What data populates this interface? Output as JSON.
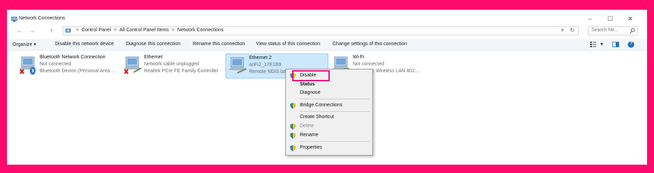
{
  "window": {
    "title": "Network Connections",
    "minimize": "–",
    "maximize": "☐",
    "close": "✕"
  },
  "nav": {
    "back": "←",
    "forward": "→",
    "up": "↑"
  },
  "address": {
    "crumbs": [
      "Control Panel",
      "All Control Panel Items",
      "Network Connections"
    ],
    "separator": ">",
    "dropdown": "∨",
    "refresh": "↻"
  },
  "search": {
    "placeholder": "Search Ne...",
    "icon": "search-icon"
  },
  "commandbar": {
    "organize": "Organize ▾",
    "disable_device": "Disable this network device",
    "diagnose": "Diagnose this connection",
    "rename": "Rename this connection",
    "view_status": "View status of this connection",
    "change_settings": "Change settings of this connection",
    "view_options": "▾",
    "preview_pane": "▯",
    "help": "?"
  },
  "connections": [
    {
      "name": "Bluetooth Network Connection",
      "status": "Not connected",
      "device": "Bluetooth Device (Personal Area ..."
    },
    {
      "name": "Ethernet",
      "status": "Network cable unplugged",
      "device": "Realtek PCIe FE Family Controller"
    },
    {
      "name": "Ethernet 2",
      "status": "aoFi2_17E1B9",
      "device": "Remote NDIS ba..."
    },
    {
      "name": "Wi-Fi",
      "status": "Not connected",
      "device": "...8821CE Wireless LAN 802...."
    }
  ],
  "context_menu": {
    "disable": "Disable",
    "status": "Status",
    "diagnose": "Diagnose",
    "bridge": "Bridge Connections",
    "shortcut": "Create Shortcut",
    "delete": "Delete",
    "rename": "Rename",
    "properties": "Properties"
  },
  "colors": {
    "frame": "#ff0a6c",
    "selection": "#cce8ff",
    "highlight": "#e8157a"
  }
}
